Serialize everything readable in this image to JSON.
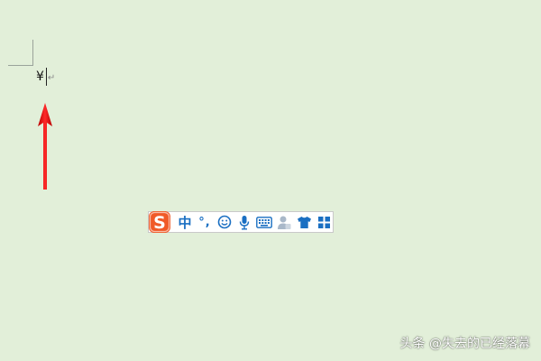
{
  "document": {
    "typed_text": "¥",
    "paragraph_mark": "↵"
  },
  "ime_toolbar": {
    "logo_letter": "S",
    "input_mode": "中",
    "punctuation_mode": "°,",
    "items": [
      {
        "name": "emoji-icon"
      },
      {
        "name": "microphone-icon"
      },
      {
        "name": "keyboard-icon"
      },
      {
        "name": "user-icon"
      },
      {
        "name": "skin-shirt-icon"
      },
      {
        "name": "toolbox-grid-icon"
      }
    ]
  },
  "watermark": {
    "text": "头条 @失去的已经落幕"
  },
  "colors": {
    "page_background": "#e2efd9",
    "annotation_arrow": "#e01010",
    "ime_accent": "#1a6fc2",
    "ime_logo": "#f05a28"
  }
}
